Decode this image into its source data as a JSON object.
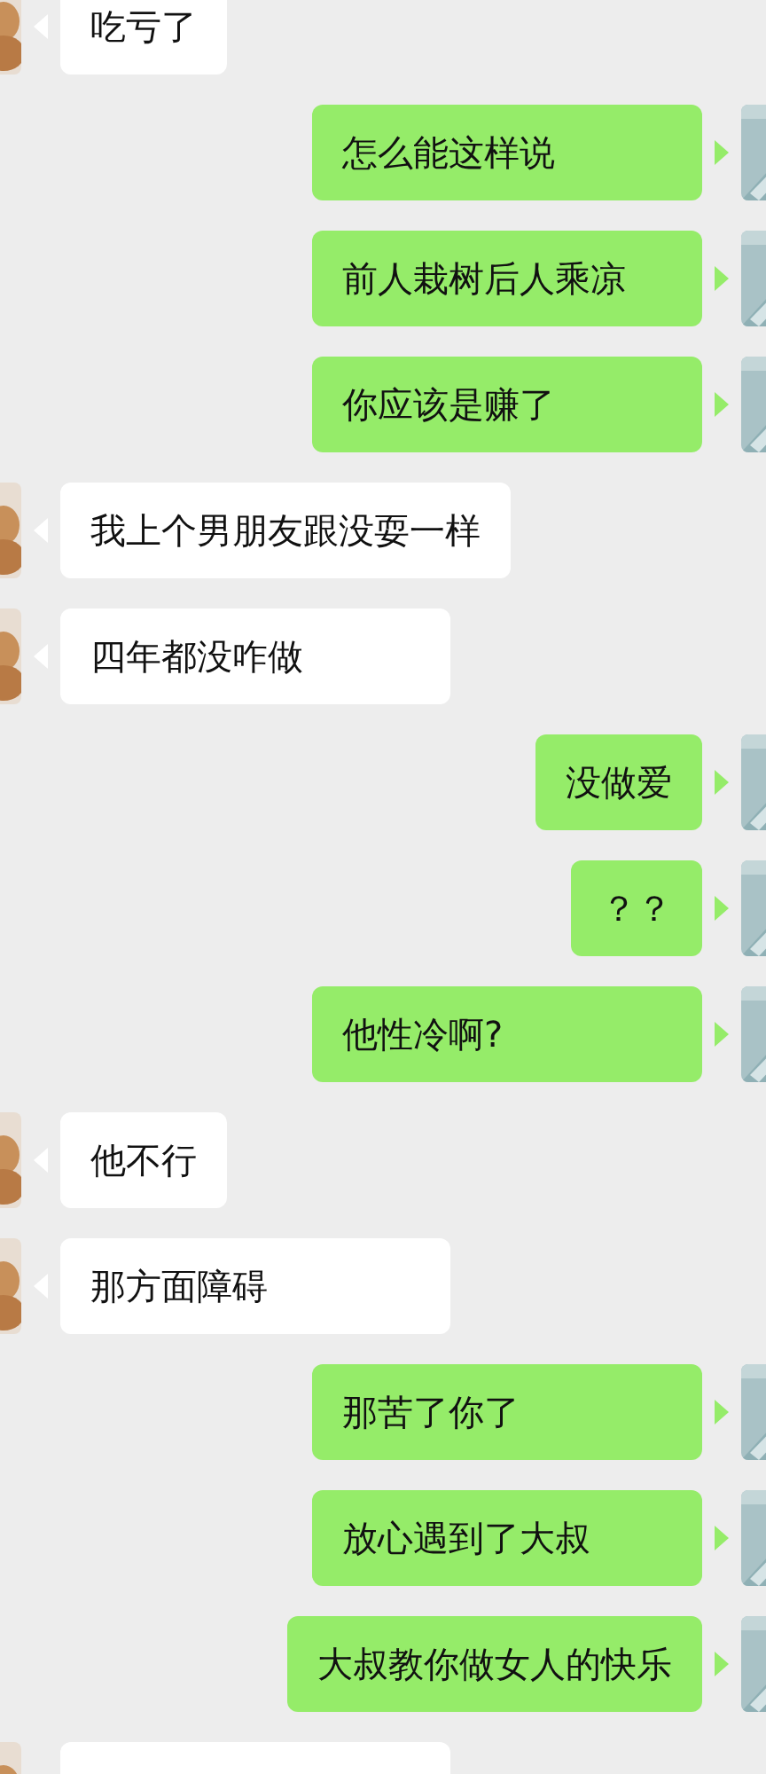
{
  "messages": [
    {
      "kind": "received",
      "text": "吃亏了"
    },
    {
      "kind": "sent",
      "text": "怎么能这样说"
    },
    {
      "kind": "sent",
      "text": "前人栽树后人乘凉"
    },
    {
      "kind": "sent",
      "text": "你应该是赚了"
    },
    {
      "kind": "received",
      "text": "我上个男朋友跟没耍一样"
    },
    {
      "kind": "received",
      "text": "四年都没咋做"
    },
    {
      "kind": "sent",
      "text": "没做爱"
    },
    {
      "kind": "sent",
      "text": "？？"
    },
    {
      "kind": "sent",
      "text": "他性冷啊?"
    },
    {
      "kind": "received",
      "text": "他不行"
    },
    {
      "kind": "received",
      "text": "那方面障碍"
    },
    {
      "kind": "sent",
      "text": "那苦了你了"
    },
    {
      "kind": "sent",
      "text": "放心遇到了大叔"
    },
    {
      "kind": "sent",
      "text": "大叔教你做女人的快乐"
    },
    {
      "kind": "received"
    }
  ]
}
